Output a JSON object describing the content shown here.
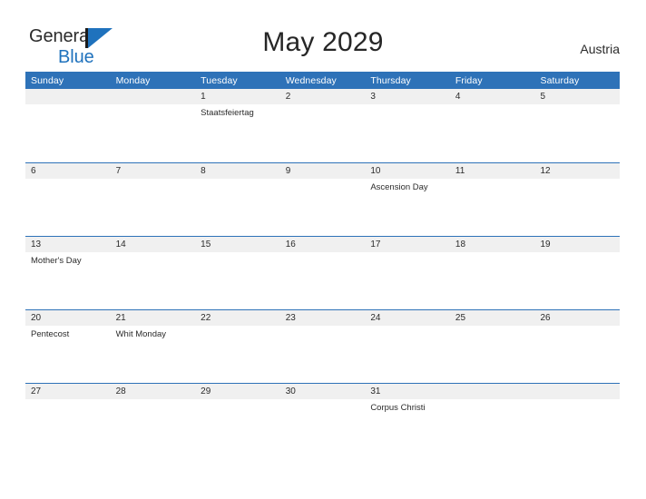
{
  "brand": {
    "name_part1": "General",
    "name_part2": "Blue",
    "mark_icon": "triangle-flag-icon",
    "accent_color": "#1f72bd"
  },
  "header": {
    "title": "May 2029",
    "month": "May",
    "year": "2029",
    "locale": "Austria"
  },
  "theme": {
    "header_blue": "#2e72b8",
    "band_gray": "#f0f0f0",
    "page_background": "#ffffff",
    "text_color": "#2b2b2b"
  },
  "weekdays": [
    {
      "label": "Sunday"
    },
    {
      "label": "Monday"
    },
    {
      "label": "Tuesday"
    },
    {
      "label": "Wednesday"
    },
    {
      "label": "Thursday"
    },
    {
      "label": "Friday"
    },
    {
      "label": "Saturday"
    }
  ],
  "weeks": [
    {
      "days": [
        {
          "number": "",
          "events": []
        },
        {
          "number": "",
          "events": []
        },
        {
          "number": "1",
          "events": [
            "Staatsfeiertag"
          ]
        },
        {
          "number": "2",
          "events": []
        },
        {
          "number": "3",
          "events": []
        },
        {
          "number": "4",
          "events": []
        },
        {
          "number": "5",
          "events": []
        }
      ]
    },
    {
      "days": [
        {
          "number": "6",
          "events": []
        },
        {
          "number": "7",
          "events": []
        },
        {
          "number": "8",
          "events": []
        },
        {
          "number": "9",
          "events": []
        },
        {
          "number": "10",
          "events": [
            "Ascension Day"
          ]
        },
        {
          "number": "11",
          "events": []
        },
        {
          "number": "12",
          "events": []
        }
      ]
    },
    {
      "days": [
        {
          "number": "13",
          "events": [
            "Mother's Day"
          ]
        },
        {
          "number": "14",
          "events": []
        },
        {
          "number": "15",
          "events": []
        },
        {
          "number": "16",
          "events": []
        },
        {
          "number": "17",
          "events": []
        },
        {
          "number": "18",
          "events": []
        },
        {
          "number": "19",
          "events": []
        }
      ]
    },
    {
      "days": [
        {
          "number": "20",
          "events": [
            "Pentecost"
          ]
        },
        {
          "number": "21",
          "events": [
            "Whit Monday"
          ]
        },
        {
          "number": "22",
          "events": []
        },
        {
          "number": "23",
          "events": []
        },
        {
          "number": "24",
          "events": []
        },
        {
          "number": "25",
          "events": []
        },
        {
          "number": "26",
          "events": []
        }
      ]
    },
    {
      "days": [
        {
          "number": "27",
          "events": []
        },
        {
          "number": "28",
          "events": []
        },
        {
          "number": "29",
          "events": []
        },
        {
          "number": "30",
          "events": []
        },
        {
          "number": "31",
          "events": [
            "Corpus Christi"
          ]
        },
        {
          "number": "",
          "events": []
        },
        {
          "number": "",
          "events": []
        }
      ]
    }
  ]
}
